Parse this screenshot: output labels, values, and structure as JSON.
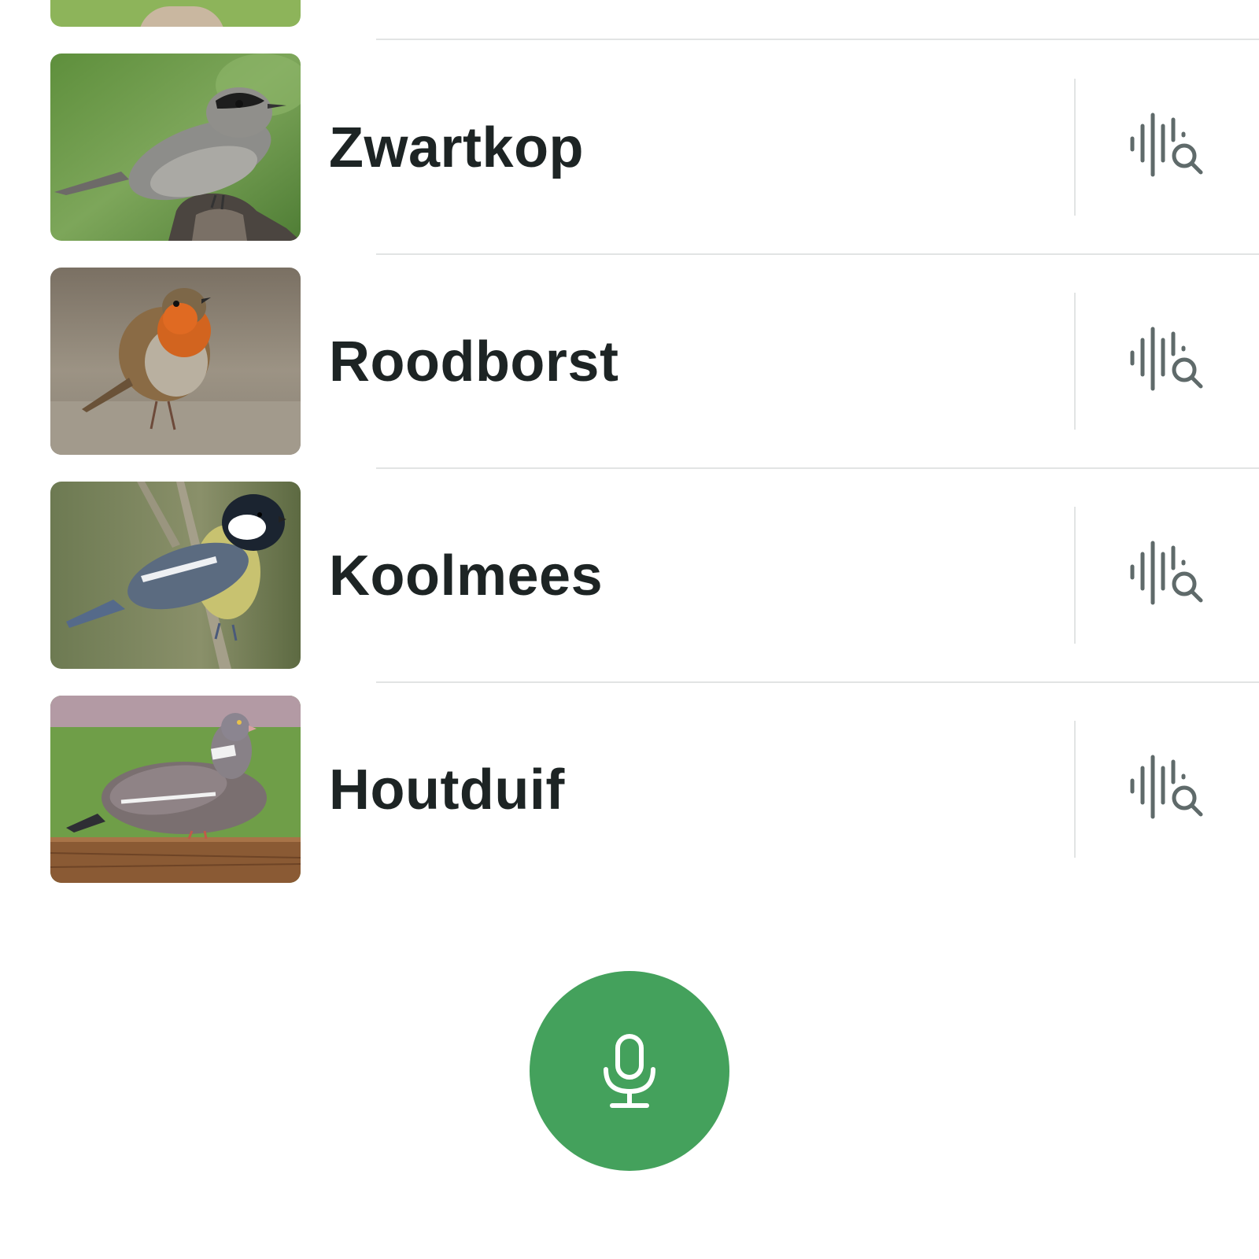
{
  "species": [
    {
      "name": "Zwartkop",
      "image_icon": "blackcap-photo"
    },
    {
      "name": "Roodborst",
      "image_icon": "robin-photo"
    },
    {
      "name": "Koolmees",
      "image_icon": "great-tit-photo"
    },
    {
      "name": "Houtduif",
      "image_icon": "wood-pigeon-photo"
    }
  ],
  "row_action_icon": "sound-search-icon",
  "record_button": {
    "icon": "microphone-icon"
  },
  "colors": {
    "accent": "#44a15c",
    "text": "#1d2424",
    "icon": "#5f6a6a",
    "divider": "#e2e4e4"
  }
}
